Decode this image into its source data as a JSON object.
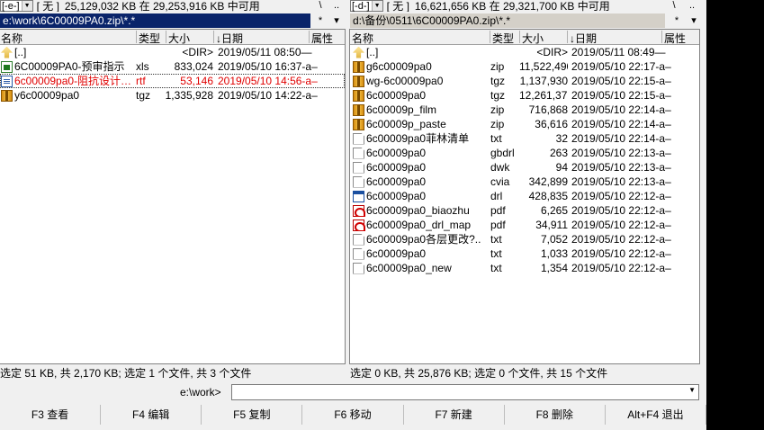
{
  "left_drive": {
    "drive": "[-e-]",
    "label": "[ 无 ]",
    "free": "25,129,032 KB 在 29,253,916 KB 中可用",
    "btn_root": "\\",
    "btn_parent": ".."
  },
  "right_drive": {
    "drive": "[-d-]",
    "label": "[ 无 ]",
    "free": "16,621,656 KB 在 29,321,700 KB 中可用",
    "btn_root": "\\",
    "btn_parent": ".."
  },
  "left_path": {
    "text": "e:\\work\\6C00009PA0.zip\\*.*",
    "star": "*",
    "arrow": "▾"
  },
  "right_path": {
    "text": "d:\\备份\\0511\\6C00009PA0.zip\\*.*",
    "star": "*",
    "arrow": "▾"
  },
  "columns": {
    "name": "名称",
    "ext": "类型",
    "size": "大小",
    "date": "↓日期",
    "attr": "属性"
  },
  "left_files": [
    {
      "icon": "up-icon",
      "name": "[..]",
      "ext": "",
      "size": "<DIR>",
      "date": "2019/05/11 08:50—",
      "selected": false,
      "focus": false
    },
    {
      "icon": "xls-icon",
      "name": "6C00009PA0-预审指示",
      "ext": "xls",
      "size": "833,024",
      "date": "2019/05/10 16:37-a–",
      "selected": false,
      "focus": false
    },
    {
      "icon": "doc-icon",
      "name": "6c00009pa0-阻抗设计…",
      "ext": "rtf",
      "size": "53,146",
      "date": "2019/05/10 14:56-a–",
      "selected": true,
      "focus": true
    },
    {
      "icon": "archive-icon",
      "name": "y6c00009pa0",
      "ext": "tgz",
      "size": "1,335,928",
      "date": "2019/05/10 14:22-a–",
      "selected": false,
      "focus": false
    }
  ],
  "right_files": [
    {
      "icon": "up-icon",
      "name": "[..]",
      "ext": "",
      "size": "<DIR>",
      "date": "2019/05/11 08:49—"
    },
    {
      "icon": "archive-icon",
      "name": "g6c00009pa0",
      "ext": "zip",
      "size": "11,522,490",
      "date": "2019/05/10 22:17-a–"
    },
    {
      "icon": "archive-icon",
      "name": "wg-6c00009pa0",
      "ext": "tgz",
      "size": "1,137,930",
      "date": "2019/05/10 22:15-a–"
    },
    {
      "icon": "archive-icon",
      "name": "6c00009pa0",
      "ext": "tgz",
      "size": "12,261,371",
      "date": "2019/05/10 22:15-a–"
    },
    {
      "icon": "archive-icon",
      "name": "6c00009p_film",
      "ext": "zip",
      "size": "716,868",
      "date": "2019/05/10 22:14-a–"
    },
    {
      "icon": "archive-icon",
      "name": "6c00009p_paste",
      "ext": "zip",
      "size": "36,616",
      "date": "2019/05/10 22:14-a–"
    },
    {
      "icon": "file-icon",
      "name": "6c00009pa0菲林清单",
      "ext": "txt",
      "size": "32",
      "date": "2019/05/10 22:14-a–"
    },
    {
      "icon": "file-icon",
      "name": "6c00009pa0",
      "ext": "gbdrl",
      "size": "263",
      "date": "2019/05/10 22:13-a–"
    },
    {
      "icon": "file-icon",
      "name": "6c00009pa0",
      "ext": "dwk",
      "size": "94",
      "date": "2019/05/10 22:13-a–"
    },
    {
      "icon": "file-icon",
      "name": "6c00009pa0",
      "ext": "cvia",
      "size": "342,899",
      "date": "2019/05/10 22:13-a–"
    },
    {
      "icon": "window-icon",
      "name": "6c00009pa0",
      "ext": "drl",
      "size": "428,835",
      "date": "2019/05/10 22:12-a–"
    },
    {
      "icon": "pdf-icon",
      "name": "6c00009pa0_biaozhu",
      "ext": "pdf",
      "size": "6,265",
      "date": "2019/05/10 22:12-a–"
    },
    {
      "icon": "pdf-icon",
      "name": "6c00009pa0_drl_map",
      "ext": "pdf",
      "size": "34,911",
      "date": "2019/05/10 22:12-a–"
    },
    {
      "icon": "file-icon",
      "name": "6c00009pa0各层更改?..",
      "ext": "txt",
      "size": "7,052",
      "date": "2019/05/10 22:12-a–"
    },
    {
      "icon": "file-icon",
      "name": "6c00009pa0",
      "ext": "txt",
      "size": "1,033",
      "date": "2019/05/10 22:12-a–"
    },
    {
      "icon": "file-icon",
      "name": "6c00009pa0_new",
      "ext": "txt",
      "size": "1,354",
      "date": "2019/05/10 22:12-a–"
    }
  ],
  "left_status": "选定 51 KB, 共 2,170 KB; 选定 1 个文件, 共 3 个文件",
  "right_status": "选定 0 KB, 共 25,876 KB; 选定 0 个文件, 共 15 个文件",
  "command_line": {
    "path": "e:\\work>",
    "value": "",
    "arrow": "▼"
  },
  "function_keys": [
    "F3 查看",
    "F4 编辑",
    "F5 复制",
    "F6 移动",
    "F7 新建",
    "F8 删除",
    "Alt+F4 退出"
  ],
  "colors": {
    "active_path": "#0a246a",
    "selected_text": "#e00000"
  }
}
